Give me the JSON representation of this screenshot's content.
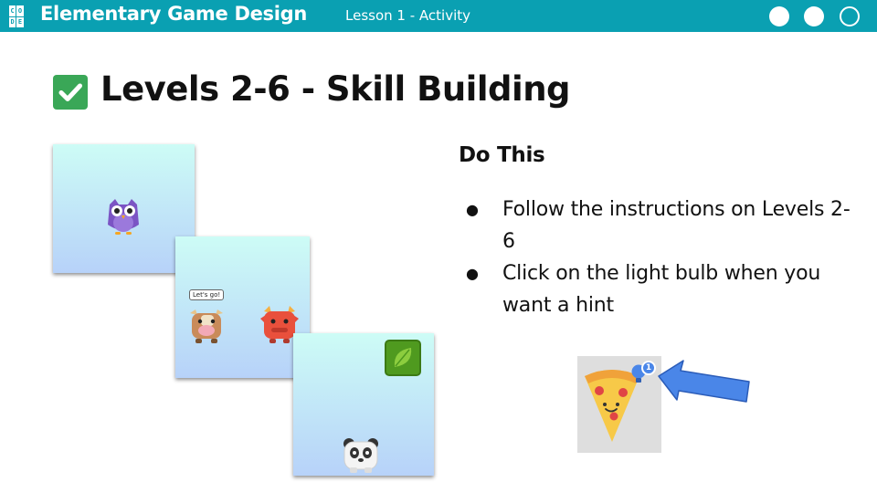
{
  "header": {
    "logo_letters": [
      "C",
      "O",
      "D",
      "E"
    ],
    "brand": "Elementary Game Design",
    "lesson": "Lesson 1 - Activity",
    "progress_dots": [
      "filled",
      "filled",
      "outline"
    ]
  },
  "title": {
    "icon": "check-box-icon",
    "text": "Levels 2-6 - Skill Building"
  },
  "instructions": {
    "heading": "Do This",
    "items": [
      "Follow the instructions on Levels 2-6",
      "Click on the light bulb when you want a hint"
    ]
  },
  "game_screens": {
    "speech_bubble": "Let's go!"
  },
  "hint": {
    "badge_count": "1",
    "icon": "lightbulb-icon"
  },
  "colors": {
    "header_bg": "#0aa0b2",
    "check_green": "#3aa757",
    "arrow_blue": "#4a86e8"
  }
}
